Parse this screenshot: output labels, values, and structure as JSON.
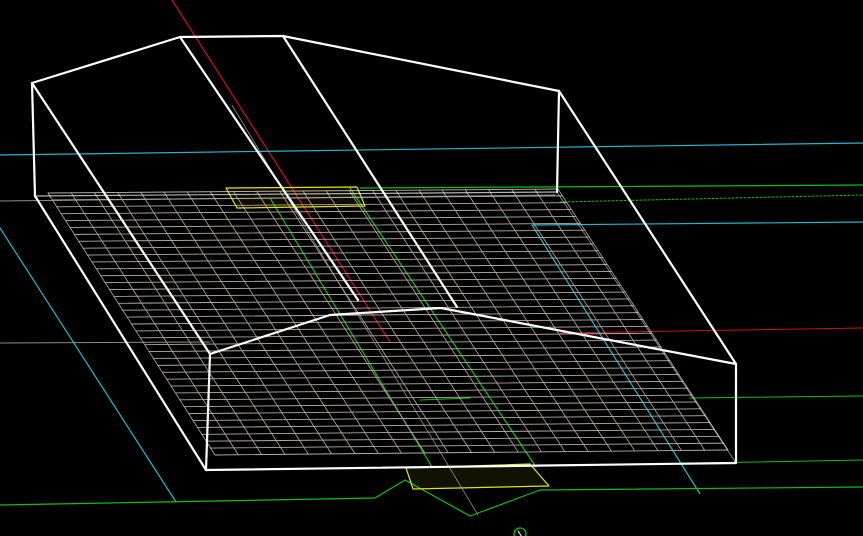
{
  "viewport": {
    "background": "#000000",
    "colors": {
      "x_axis": "#d01010",
      "guide_cyan": "#20b8d0",
      "alignment_green": "#10c010",
      "footing_yellow": "#e0e020",
      "building_wire": "#ffffff",
      "grid_mesh": "#b8aaa6",
      "construction_grey": "#8c8c8c"
    },
    "layers": [
      "x-axis",
      "cyan-guides",
      "green-alignments",
      "ground-mesh",
      "footing-pads",
      "building-wireframe",
      "ucs-marker"
    ],
    "ucs_marker_icon": "ucs-origin-icon"
  }
}
